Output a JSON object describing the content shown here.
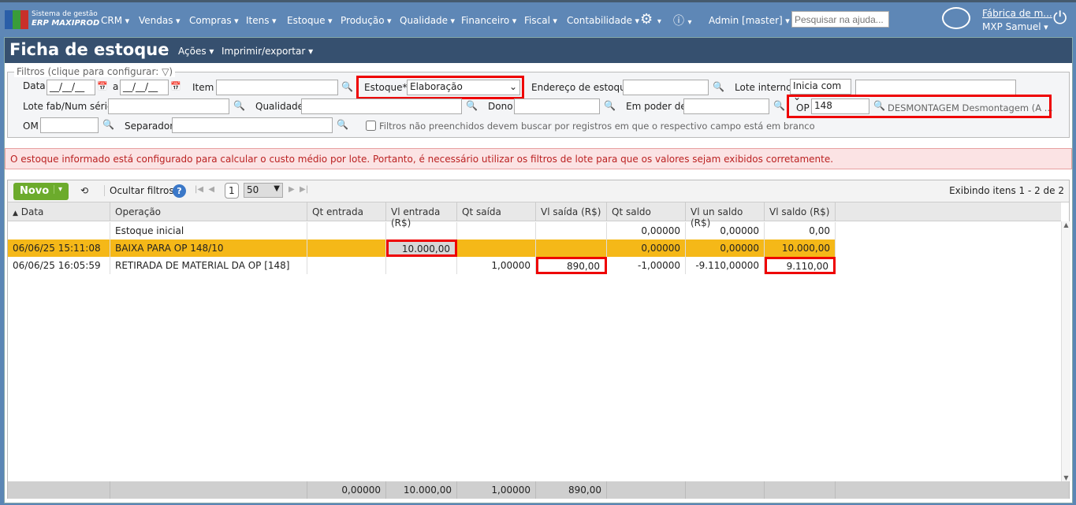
{
  "app": {
    "logo_line1": "Sistema de gestão",
    "logo_line2": "ERP MAXIPROD",
    "company": "Fábrica de m...",
    "user": "MXP Samuel",
    "admin": "Admin [master]",
    "help_placeholder": "Pesquisar na ajuda..."
  },
  "nav": [
    "CRM",
    "Vendas",
    "Compras",
    "Itens",
    "Estoque",
    "Produção",
    "Qualidade",
    "Financeiro",
    "Fiscal",
    "Contabilidade"
  ],
  "page": {
    "title": "Ficha de estoque",
    "menu_actions": "Ações",
    "menu_print": "Imprimir/exportar"
  },
  "filters": {
    "legend": "Filtros (clique para configurar:",
    "data": "Data",
    "date_from": "__/__/__",
    "a": "a",
    "date_to": "__/__/__",
    "item": "Item",
    "estoque": "Estoque*",
    "estoque_value": "Elaboração",
    "endereco": "Endereço de estoque",
    "lote_interno": "Lote interno",
    "lote_interno_mode": "Inicia com",
    "lote_fab": "Lote fab/Num série",
    "qualidade": "Qualidade",
    "dono": "Dono",
    "em_poder": "Em poder de",
    "op": "OP",
    "op_value": "148",
    "op_desc": "DESMONTAGEM Desmontagem (A ...",
    "om": "OM",
    "separador": "Separador",
    "blank_check": "Filtros não preenchidos devem buscar por registros em que o respectivo campo está em branco"
  },
  "alert": "O estoque informado está configurado para calcular o custo médio por lote. Portanto, é necessário utilizar os filtros de lote para que os valores sejam exibidos corretamente.",
  "toolbar": {
    "novo": "Novo",
    "hide_filters": "Ocultar filtros",
    "page": "1",
    "page_size": "50",
    "count": "Exibindo itens 1 - 2 de 2"
  },
  "columns": [
    "Data",
    "Operação",
    "Qt entrada",
    "Vl entrada (R$)",
    "Qt saída",
    "Vl saída (R$)",
    "Qt saldo",
    "Vl un saldo (R$)",
    "Vl saldo (R$)"
  ],
  "rows": [
    [
      "",
      "Estoque inicial",
      "",
      "",
      "",
      "",
      "0,00000",
      "0,00000",
      "0,00"
    ],
    [
      "06/06/25 15:11:08",
      "BAIXA PARA OP 148/10",
      "",
      "10.000,00",
      "",
      "",
      "0,00000",
      "0,00000",
      "10.000,00"
    ],
    [
      "06/06/25 16:05:59",
      "RETIRADA DE MATERIAL DA OP [148]",
      "",
      "",
      "1,00000",
      "890,00",
      "-1,00000",
      "-9.110,00000",
      "9.110,00"
    ]
  ],
  "totals": [
    "",
    "",
    "0,00000",
    "10.000,00",
    "1,00000",
    "890,00",
    "",
    "",
    ""
  ]
}
